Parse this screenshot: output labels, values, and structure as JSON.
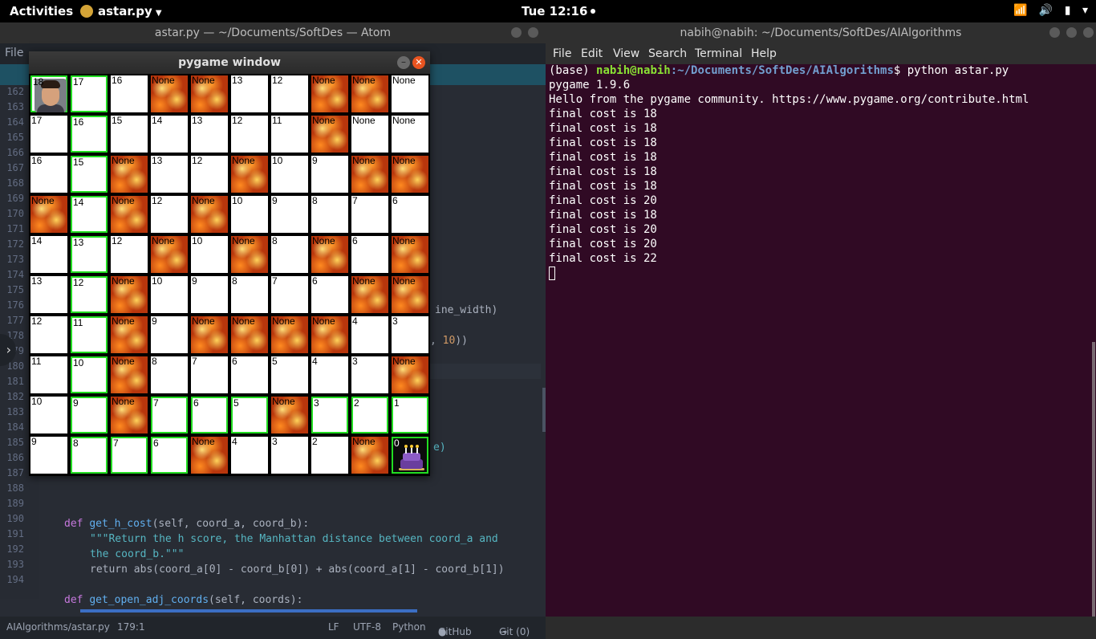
{
  "topbar": {
    "activities": "Activities",
    "app_name": "astar.py",
    "clock": "Tue 12:16",
    "icons": [
      "wifi-icon",
      "volume-icon",
      "battery-icon",
      "chevron-down-icon"
    ]
  },
  "atom": {
    "title": "astar.py — ~/Documents/SoftDes — Atom",
    "menu_file": "File",
    "line_numbers": [
      "162",
      "163",
      "164",
      "165",
      "166",
      "167",
      "168",
      "169",
      "170",
      "171",
      "172",
      "173",
      "174",
      "175",
      "176",
      "177",
      "178",
      "179",
      "180",
      "181",
      "182",
      "183",
      "184",
      "185",
      "186",
      "187",
      "188",
      "189",
      "190",
      "191",
      "192",
      "193",
      "194"
    ],
    "visible_code": {
      "l175": "ine_width)",
      "l177_num": "10",
      "l177_end": "))",
      "l184": "e)",
      "l189_def": "def",
      "l189_fn": "get_h_cost",
      "l189_rest": "(self, coord_a, coord_b):",
      "l190": "\"\"\"Return the h score, the Manhattan distance between coord_a and",
      "l191": "the coord_b.\"\"\"",
      "l192": "return abs(coord_a[0] - coord_b[0]) + abs(coord_a[1] - coord_b[1])",
      "l194_def": "def",
      "l194_fn": "get_open_adj_coords",
      "l194_rest": "(self, coords):"
    },
    "status": {
      "file": "AIAlgorithms/astar.py",
      "cursor": "179:1",
      "line_ending": "LF",
      "encoding": "UTF-8",
      "grammar": "Python",
      "github": "GitHub",
      "git": "Git (0)"
    }
  },
  "terminal": {
    "title": "nabih@nabih: ~/Documents/SoftDes/AIAlgorithms",
    "menu": [
      "File",
      "Edit",
      "View",
      "Search",
      "Terminal",
      "Help"
    ],
    "prompt_env": "(base) ",
    "prompt_user": "nabih@nabih",
    "prompt_path": ":~/Documents/SoftDes/AIAlgorithms",
    "prompt_cmd": "$ python astar.py",
    "output": [
      "pygame 1.9.6",
      "Hello from the pygame community. https://www.pygame.org/contribute.html",
      "final cost is 18",
      "final cost is 18",
      "final cost is 18",
      "final cost is 18",
      "final cost is 18",
      "final cost is 18",
      "final cost is 20",
      "final cost is 18",
      "final cost is 20",
      "final cost is 20",
      "final cost is 22"
    ]
  },
  "pygame": {
    "title": "pygame window",
    "min_icon": "–",
    "close_icon": "✕",
    "grid": [
      [
        {
          "t": "18",
          "k": "start",
          "p": 1
        },
        {
          "t": "17",
          "k": "empty",
          "p": 1
        },
        {
          "t": "16",
          "k": "empty",
          "p": 0
        },
        {
          "t": "None",
          "k": "fire",
          "p": 0
        },
        {
          "t": "None",
          "k": "fire",
          "p": 0
        },
        {
          "t": "13",
          "k": "empty",
          "p": 0
        },
        {
          "t": "12",
          "k": "empty",
          "p": 0
        },
        {
          "t": "None",
          "k": "fire",
          "p": 0
        },
        {
          "t": "None",
          "k": "fire",
          "p": 0
        },
        {
          "t": "None",
          "k": "empty",
          "p": 0
        }
      ],
      [
        {
          "t": "17",
          "k": "empty",
          "p": 0
        },
        {
          "t": "16",
          "k": "empty",
          "p": 1
        },
        {
          "t": "15",
          "k": "empty",
          "p": 0
        },
        {
          "t": "14",
          "k": "empty",
          "p": 0
        },
        {
          "t": "13",
          "k": "empty",
          "p": 0
        },
        {
          "t": "12",
          "k": "empty",
          "p": 0
        },
        {
          "t": "11",
          "k": "empty",
          "p": 0
        },
        {
          "t": "None",
          "k": "fire",
          "p": 0
        },
        {
          "t": "None",
          "k": "empty",
          "p": 0
        },
        {
          "t": "None",
          "k": "empty",
          "p": 0
        }
      ],
      [
        {
          "t": "16",
          "k": "empty",
          "p": 0
        },
        {
          "t": "15",
          "k": "empty",
          "p": 1
        },
        {
          "t": "None",
          "k": "fire",
          "p": 0
        },
        {
          "t": "13",
          "k": "empty",
          "p": 0
        },
        {
          "t": "12",
          "k": "empty",
          "p": 0
        },
        {
          "t": "None",
          "k": "fire",
          "p": 0
        },
        {
          "t": "10",
          "k": "empty",
          "p": 0
        },
        {
          "t": "9",
          "k": "empty",
          "p": 0
        },
        {
          "t": "None",
          "k": "fire",
          "p": 0
        },
        {
          "t": "None",
          "k": "fire",
          "p": 0
        }
      ],
      [
        {
          "t": "None",
          "k": "fire",
          "p": 0
        },
        {
          "t": "14",
          "k": "empty",
          "p": 1
        },
        {
          "t": "None",
          "k": "fire",
          "p": 0
        },
        {
          "t": "12",
          "k": "empty",
          "p": 0
        },
        {
          "t": "None",
          "k": "fire",
          "p": 0
        },
        {
          "t": "10",
          "k": "empty",
          "p": 0
        },
        {
          "t": "9",
          "k": "empty",
          "p": 0
        },
        {
          "t": "8",
          "k": "empty",
          "p": 0
        },
        {
          "t": "7",
          "k": "empty",
          "p": 0
        },
        {
          "t": "6",
          "k": "empty",
          "p": 0
        }
      ],
      [
        {
          "t": "14",
          "k": "empty",
          "p": 0
        },
        {
          "t": "13",
          "k": "empty",
          "p": 1
        },
        {
          "t": "12",
          "k": "empty",
          "p": 0
        },
        {
          "t": "None",
          "k": "fire",
          "p": 0
        },
        {
          "t": "10",
          "k": "empty",
          "p": 0
        },
        {
          "t": "None",
          "k": "fire",
          "p": 0
        },
        {
          "t": "8",
          "k": "empty",
          "p": 0
        },
        {
          "t": "None",
          "k": "fire",
          "p": 0
        },
        {
          "t": "6",
          "k": "empty",
          "p": 0
        },
        {
          "t": "None",
          "k": "fire",
          "p": 0
        }
      ],
      [
        {
          "t": "13",
          "k": "empty",
          "p": 0
        },
        {
          "t": "12",
          "k": "empty",
          "p": 1
        },
        {
          "t": "None",
          "k": "fire",
          "p": 0
        },
        {
          "t": "10",
          "k": "empty",
          "p": 0
        },
        {
          "t": "9",
          "k": "empty",
          "p": 0
        },
        {
          "t": "8",
          "k": "empty",
          "p": 0
        },
        {
          "t": "7",
          "k": "empty",
          "p": 0
        },
        {
          "t": "6",
          "k": "empty",
          "p": 0
        },
        {
          "t": "None",
          "k": "fire",
          "p": 0
        },
        {
          "t": "None",
          "k": "fire",
          "p": 0
        }
      ],
      [
        {
          "t": "12",
          "k": "empty",
          "p": 0
        },
        {
          "t": "11",
          "k": "empty",
          "p": 1
        },
        {
          "t": "None",
          "k": "fire",
          "p": 0
        },
        {
          "t": "9",
          "k": "empty",
          "p": 0
        },
        {
          "t": "None",
          "k": "fire",
          "p": 0
        },
        {
          "t": "None",
          "k": "fire",
          "p": 0
        },
        {
          "t": "None",
          "k": "fire",
          "p": 0
        },
        {
          "t": "None",
          "k": "fire",
          "p": 0
        },
        {
          "t": "4",
          "k": "empty",
          "p": 0
        },
        {
          "t": "3",
          "k": "empty",
          "p": 0
        }
      ],
      [
        {
          "t": "11",
          "k": "empty",
          "p": 0
        },
        {
          "t": "10",
          "k": "empty",
          "p": 1
        },
        {
          "t": "None",
          "k": "fire",
          "p": 0
        },
        {
          "t": "8",
          "k": "empty",
          "p": 0
        },
        {
          "t": "7",
          "k": "empty",
          "p": 0
        },
        {
          "t": "6",
          "k": "empty",
          "p": 0
        },
        {
          "t": "5",
          "k": "empty",
          "p": 0
        },
        {
          "t": "4",
          "k": "empty",
          "p": 0
        },
        {
          "t": "3",
          "k": "empty",
          "p": 0
        },
        {
          "t": "None",
          "k": "fire",
          "p": 0
        }
      ],
      [
        {
          "t": "10",
          "k": "empty",
          "p": 0
        },
        {
          "t": "9",
          "k": "empty",
          "p": 1
        },
        {
          "t": "None",
          "k": "fire",
          "p": 0
        },
        {
          "t": "7",
          "k": "empty",
          "p": 1
        },
        {
          "t": "6",
          "k": "empty",
          "p": 1
        },
        {
          "t": "5",
          "k": "empty",
          "p": 1
        },
        {
          "t": "None",
          "k": "fire",
          "p": 0
        },
        {
          "t": "3",
          "k": "empty",
          "p": 1
        },
        {
          "t": "2",
          "k": "empty",
          "p": 1
        },
        {
          "t": "1",
          "k": "empty",
          "p": 1
        }
      ],
      [
        {
          "t": "9",
          "k": "empty",
          "p": 0
        },
        {
          "t": "8",
          "k": "empty",
          "p": 1
        },
        {
          "t": "7",
          "k": "empty",
          "p": 1
        },
        {
          "t": "6",
          "k": "empty",
          "p": 1
        },
        {
          "t": "None",
          "k": "fire",
          "p": 0
        },
        {
          "t": "4",
          "k": "empty",
          "p": 0
        },
        {
          "t": "3",
          "k": "empty",
          "p": 0
        },
        {
          "t": "2",
          "k": "empty",
          "p": 0
        },
        {
          "t": "None",
          "k": "fire",
          "p": 0
        },
        {
          "t": "0",
          "k": "goal",
          "p": 1
        }
      ]
    ]
  }
}
